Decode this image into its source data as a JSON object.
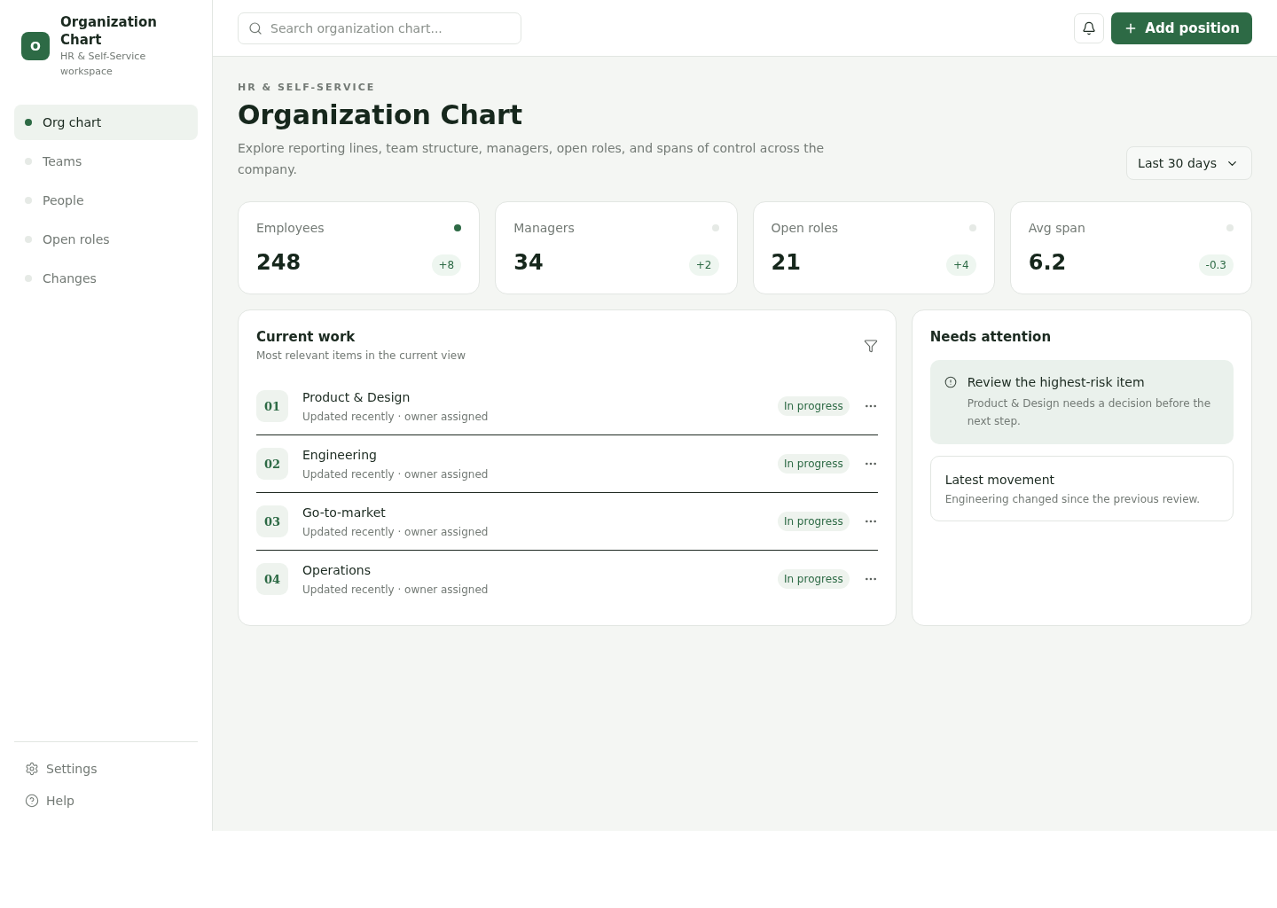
{
  "sidebar": {
    "brand": {
      "logo_letter": "O",
      "title": "Organization Chart",
      "subtitle": "HR & Self-Service workspace"
    },
    "nav": [
      {
        "label": "Org chart",
        "selected": true
      },
      {
        "label": "Teams",
        "selected": false
      },
      {
        "label": "People",
        "selected": false
      },
      {
        "label": "Open roles",
        "selected": false
      },
      {
        "label": "Changes",
        "selected": false
      }
    ],
    "footer": [
      {
        "kind": "settings",
        "label": "Settings"
      },
      {
        "kind": "help",
        "label": "Help"
      }
    ]
  },
  "topbar": {
    "search": {
      "placeholder": "Search organization chart..."
    },
    "primary_button": "Add position"
  },
  "header": {
    "eyebrow": "HR & SELF-SERVICE",
    "title": "Organization Chart",
    "description": "Explore reporting lines, team structure, managers, open roles, and spans of control across the company.",
    "period": "Last 30 days"
  },
  "stats": [
    {
      "label": "Employees",
      "value": "248",
      "change": "+8",
      "color": "#2d6a45"
    },
    {
      "label": "Managers",
      "value": "34",
      "change": "+2",
      "color": "#e6eae6"
    },
    {
      "label": "Open roles",
      "value": "21",
      "change": "+4",
      "color": "#e6eae6"
    },
    {
      "label": "Avg span",
      "value": "6.2",
      "change": "-0.3",
      "color": "#e6eae6"
    }
  ],
  "current_work": {
    "title": "Current work",
    "subtitle": "Most relevant items in the current view",
    "rows": [
      {
        "index": "01",
        "name": "Product & Design",
        "meta": "Updated recently · owner assigned",
        "status": "In progress"
      },
      {
        "index": "02",
        "name": "Engineering",
        "meta": "Updated recently · owner assigned",
        "status": "In progress"
      },
      {
        "index": "03",
        "name": "Go-to-market",
        "meta": "Updated recently · owner assigned",
        "status": "In progress"
      },
      {
        "index": "04",
        "name": "Operations",
        "meta": "Updated recently · owner assigned",
        "status": "In progress"
      }
    ]
  },
  "attention": {
    "title": "Needs attention",
    "items": [
      {
        "kind": "alert",
        "title": "Review the highest-risk item",
        "text": "Product & Design needs a decision before the next step."
      },
      {
        "kind": "note",
        "title": "Latest movement",
        "text": "Engineering changed since the previous review."
      }
    ]
  }
}
